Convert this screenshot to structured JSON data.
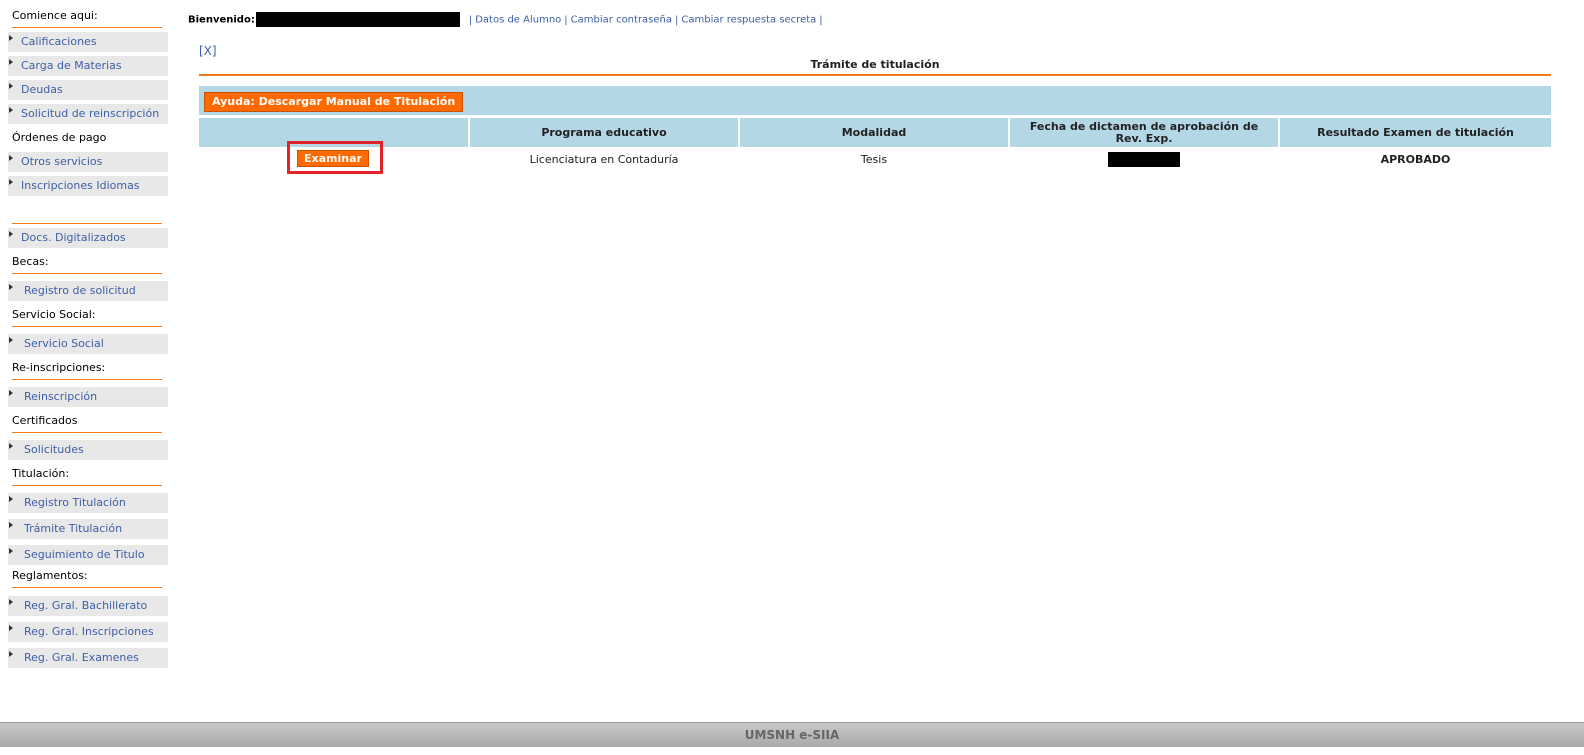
{
  "header": {
    "welcome_label": "Bienvenido:",
    "links": [
      "Datos de Alumno",
      "Cambiar contraseña",
      "Cambiar respuesta secreta"
    ]
  },
  "sidebar": {
    "start_title": "Comience aqui:",
    "items_1": [
      "Calificaciones",
      "Carga de Materias",
      "Deudas",
      "Solicitud de reinscripción"
    ],
    "ordenes_label": "Órdenes de pago",
    "items_2": [
      "Otros servicios",
      "Inscripciones Idiomas"
    ],
    "docs": "Docs. Digitalizados",
    "becas_title": "Becas:",
    "becas_item": "Registro de solicitud",
    "ss_title": "Servicio Social:",
    "ss_item": "Servicio Social",
    "reins_title": "Re-inscripciones:",
    "reins_item": "Reinscripción",
    "cert_title": "Certificados",
    "cert_item": "Solicitudes",
    "tit_title": "Titulación:",
    "tit_items": [
      "Registro Titulación",
      "Trámite Titulación",
      "Seguimiento de Titulo"
    ],
    "reg_title": "Reglamentos:",
    "reg_items": [
      "Reg. Gral. Bachillerato",
      "Reg. Gral. Inscripciones",
      "Reg. Gral. Examenes"
    ]
  },
  "main": {
    "close_label": "[X]",
    "title": "Trámite de titulación",
    "help_button": "Ayuda: Descargar Manual de Titulación",
    "columns": [
      "",
      "Programa educativo",
      "Modalidad",
      "Fecha de dictamen de aprobación de Rev. Exp.",
      "Resultado Examen de titulación"
    ],
    "row": {
      "action_button": "Examinar",
      "programa": "Licenciatura en Contaduría",
      "modalidad": "Tesis",
      "resultado": "APROBADO"
    }
  },
  "footer": {
    "text": "UMSNH e-SIIA"
  },
  "colors": {
    "accent_orange": "#ff6a00",
    "table_header_blue": "#b4d7e6",
    "link_blue": "#3d5fa6",
    "highlight_red": "#e2232a"
  }
}
